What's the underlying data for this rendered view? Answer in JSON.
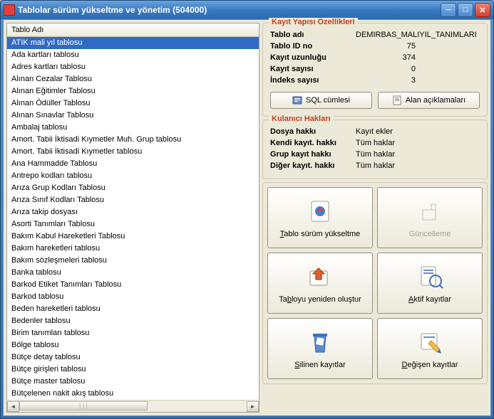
{
  "window": {
    "title": "Tablolar sürüm yükseltme ve yönetim (504000)"
  },
  "list": {
    "header": "Tablo Adı",
    "items": [
      "ATIK mali yıl tablosu",
      "Ada kartları tablosu",
      "Adres kartları tablosu",
      "Alınan Cezalar Tablosu",
      "Alınan Eğitimler Tablosu",
      "Alınan Ödüller Tablosu",
      "Alınan Sınavlar Tablosu",
      "Ambalaj tablosu",
      "Amort. Tabii İktisadi Kıymetler Muh. Grup tablosu",
      "Amort. Tabii İktisadi Kıymetler tablosu",
      "Ana Hammadde Tablosu",
      "Antrepo kodları tablosu",
      "Arıza Grup Kodları Tablosu",
      "Arıza Sınıf Kodları Tablosu",
      "Arıza takip dosyası",
      "Asorti Tanımları Tablosu",
      "Bakım Kabul Hareketleri Tablosu",
      "Bakım hareketleri tablosu",
      "Bakım sözleşmeleri tablosu",
      "Banka tablosu",
      "Barkod Etiket Tanımları Tablosu",
      "Barkod tablosu",
      "Beden hareketleri tablosu",
      "Bedenler tablosu",
      "Birim tanımları tablosu",
      "Bölge tablosu",
      "Bütçe detay tablosu",
      "Bütçe girişleri tablosu",
      "Bütçe master tablosu",
      "Bütçelenen nakit akış tablosu"
    ],
    "selected_index": 0
  },
  "record_props": {
    "legend": "Kayıt Yapısı Özellikleri",
    "rows": {
      "tablo_adi_k": "Tablo adı",
      "tablo_adi_v": "DEMIRBAS_MALIYIL_TANIMLARI",
      "tablo_id_k": "Tablo ID no",
      "tablo_id_v": "75",
      "kayit_uz_k": "Kayıt uzunluğu",
      "kayit_uz_v": "374",
      "kayit_say_k": "Kayıt sayısı",
      "kayit_say_v": "0",
      "indeks_k": "İndeks sayısı",
      "indeks_v": "3"
    },
    "sql_btn": "SQL cümlesi",
    "alan_btn": "Alan açıklamaları"
  },
  "user_rights": {
    "legend": "Kulanıcı Hakları",
    "rows": {
      "dosya_k": "Dosya hakkı",
      "dosya_v": "Kayıt ekler",
      "kendi_k": "Kendi kayıt. hakkı",
      "kendi_v": "Tüm haklar",
      "grup_k": "Grup kayıt hakkı",
      "grup_v": "Tüm haklar",
      "diger_k": "Diğer kayıt. hakkı",
      "diger_v": "Tüm haklar"
    }
  },
  "big_buttons": {
    "upgrade": "Tablo sürüm yükseltme",
    "update": "Güncelleme",
    "recreate": "Tabloyu yeniden oluştur",
    "active": "Aktif kayıtlar",
    "deleted": "Silinen kayıtlar",
    "changed": "Değişen kayıtlar"
  }
}
